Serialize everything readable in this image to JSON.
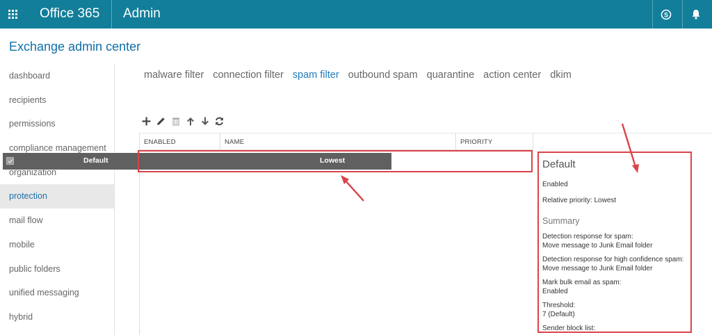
{
  "topbar": {
    "brand": "Office 365",
    "app": "Admin"
  },
  "header": {
    "title": "Exchange admin center"
  },
  "nav": {
    "items": [
      {
        "label": "dashboard"
      },
      {
        "label": "recipients"
      },
      {
        "label": "permissions"
      },
      {
        "label": "compliance management"
      },
      {
        "label": "organization"
      },
      {
        "label": "protection"
      },
      {
        "label": "mail flow"
      },
      {
        "label": "mobile"
      },
      {
        "label": "public folders"
      },
      {
        "label": "unified messaging"
      },
      {
        "label": "hybrid"
      }
    ],
    "active": "protection"
  },
  "tabs": [
    {
      "label": "malware filter"
    },
    {
      "label": "connection filter"
    },
    {
      "label": "spam filter"
    },
    {
      "label": "outbound spam"
    },
    {
      "label": "quarantine"
    },
    {
      "label": "action center"
    },
    {
      "label": "dkim"
    }
  ],
  "active_tab": "spam filter",
  "table": {
    "columns": [
      "ENABLED",
      "NAME",
      "PRIORITY"
    ],
    "rows": [
      {
        "enabled": true,
        "name": "Default",
        "priority": "Lowest"
      }
    ]
  },
  "details": {
    "title": "Default",
    "enabled": "Enabled",
    "relative_priority": "Relative priority: Lowest",
    "summary_heading": "Summary",
    "spam_label": "Detection response for spam:",
    "spam_value": "Move message to Junk Email folder",
    "high_conf_label": "Detection response for high confidence spam:",
    "high_conf_value": "Move message to Junk Email folder",
    "bulk_label": "Mark bulk email as spam:",
    "bulk_value": "Enabled",
    "threshold_label": "Threshold:",
    "threshold_value": "7 (Default)",
    "sender_block_label": "Sender block list:"
  },
  "colors": {
    "topbar": "#127e99",
    "accent": "#1e7bbd",
    "highlight": "#d9434a",
    "selected_row": "#606060"
  }
}
